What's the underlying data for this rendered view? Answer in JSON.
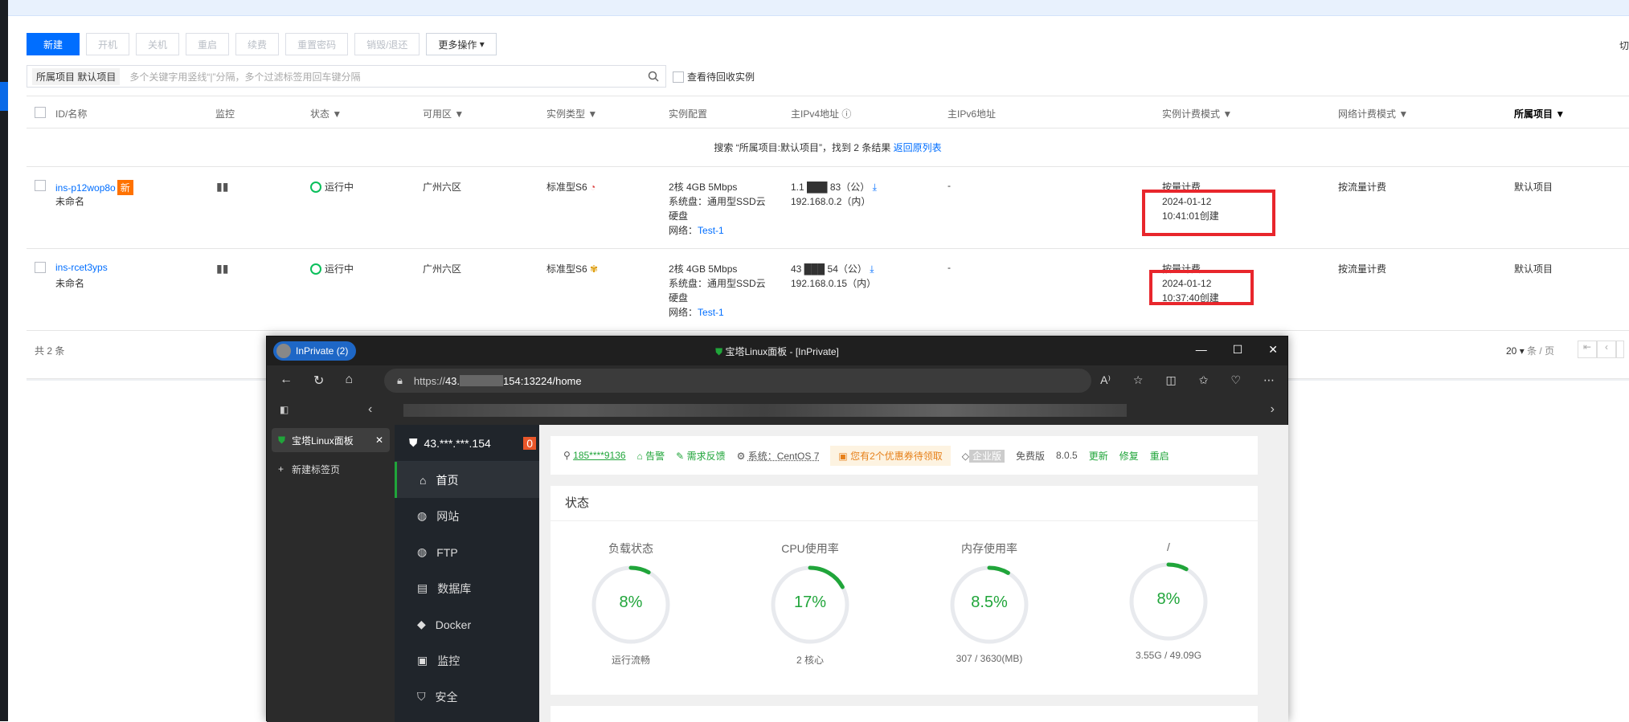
{
  "toolbar": {
    "new": "新建",
    "start": "开机",
    "stop": "关机",
    "restart": "重启",
    "renew": "续费",
    "reset_pwd": "重置密码",
    "destroy": "销毁/退还",
    "more": "更多操作"
  },
  "cut_label": "切",
  "search": {
    "tag_label": "所属项目",
    "tag_value": "默认项目",
    "placeholder": "多个关键字用竖线“|”分隔，多个过滤标签用回车键分隔",
    "recycle": "查看待回收实例"
  },
  "table": {
    "headers": {
      "id": "ID/名称",
      "monitor": "监控",
      "status": "状态",
      "zone": "可用区",
      "type": "实例类型",
      "config": "实例配置",
      "ipv4": "主IPv4地址",
      "ipv6": "主IPv6地址",
      "billing": "实例计费模式",
      "net_billing": "网络计费模式",
      "project": "所属项目"
    },
    "notice_prefix": "搜索 “所属项目:默认项目”，找到 2 条结果",
    "notice_link": "返回原列表",
    "rows": [
      {
        "id": "ins-p12wop8o",
        "badge": "新",
        "name": "未命名",
        "status": "运行中",
        "zone": "广州六区",
        "type": "标准型S6",
        "cfg1": "2核 4GB 5Mbps",
        "cfg2": "系统盘：通用型SSD云",
        "cfg3": "硬盘",
        "cfg4": "网络：",
        "net": "Test-1",
        "ip_pub": "1.1 ███ 83（公）",
        "ip_priv": "192.168.0.2（内）",
        "ipv6": "-",
        "bill": "按量计费",
        "date": "2024-01-12",
        "time": "10:41:01创建",
        "netbill": "按流量计费",
        "project": "默认项目"
      },
      {
        "id": "ins-rcet3yps",
        "badge": "",
        "name": "未命名",
        "status": "运行中",
        "zone": "广州六区",
        "type": "标准型S6",
        "cfg1": "2核 4GB 5Mbps",
        "cfg2": "系统盘：通用型SSD云",
        "cfg3": "硬盘",
        "cfg4": "网络：",
        "net": "Test-1",
        "ip_pub": "43 ███ 54（公）",
        "ip_priv": "192.168.0.15（内）",
        "ipv6": "-",
        "bill": "按量计费",
        "date": "2024-01-12",
        "time": "10:37:40创建",
        "netbill": "按流量计费",
        "project": "默认项目"
      }
    ],
    "total": "共 2 条",
    "page_size": "20",
    "page_unit": "条 / 页"
  },
  "browser": {
    "inprivate": "InPrivate (2)",
    "title": "宝塔Linux面板 - [InPrivate]",
    "url_prefix": "https://",
    "url_host": "43.",
    "url_suffix": "154:13224/home",
    "tab": "宝塔Linux面板",
    "new_tab": "新建标签页"
  },
  "bt": {
    "host": "43.***.***.154",
    "badge": "0",
    "menu": [
      "首页",
      "网站",
      "FTP",
      "数据库",
      "Docker",
      "监控",
      "安全"
    ],
    "user": "185****9136",
    "alarm": "告警",
    "feedback": "需求反馈",
    "system": "系统：CentOS 7",
    "coupon": "您有2个优惠券待领取",
    "enterprise": "企业版",
    "free": "免费版",
    "version": "8.0.5",
    "update": "更新",
    "repair": "修复",
    "reboot": "重启",
    "status_title": "状态",
    "gauges": [
      {
        "title": "负载状态",
        "value": "8%",
        "sub": "运行流畅",
        "pct": 8
      },
      {
        "title": "CPU使用率",
        "value": "17%",
        "sub": "2 核心",
        "pct": 17
      },
      {
        "title": "内存使用率",
        "value": "8.5%",
        "sub": "307 / 3630(MB)",
        "pct": 8.5
      },
      {
        "title": "/",
        "value": "8%",
        "sub": "3.55G / 49.09G",
        "pct": 8
      }
    ]
  },
  "colors": {
    "accent": "#006eff",
    "green": "#20a53a",
    "red_box": "#e8262c"
  }
}
